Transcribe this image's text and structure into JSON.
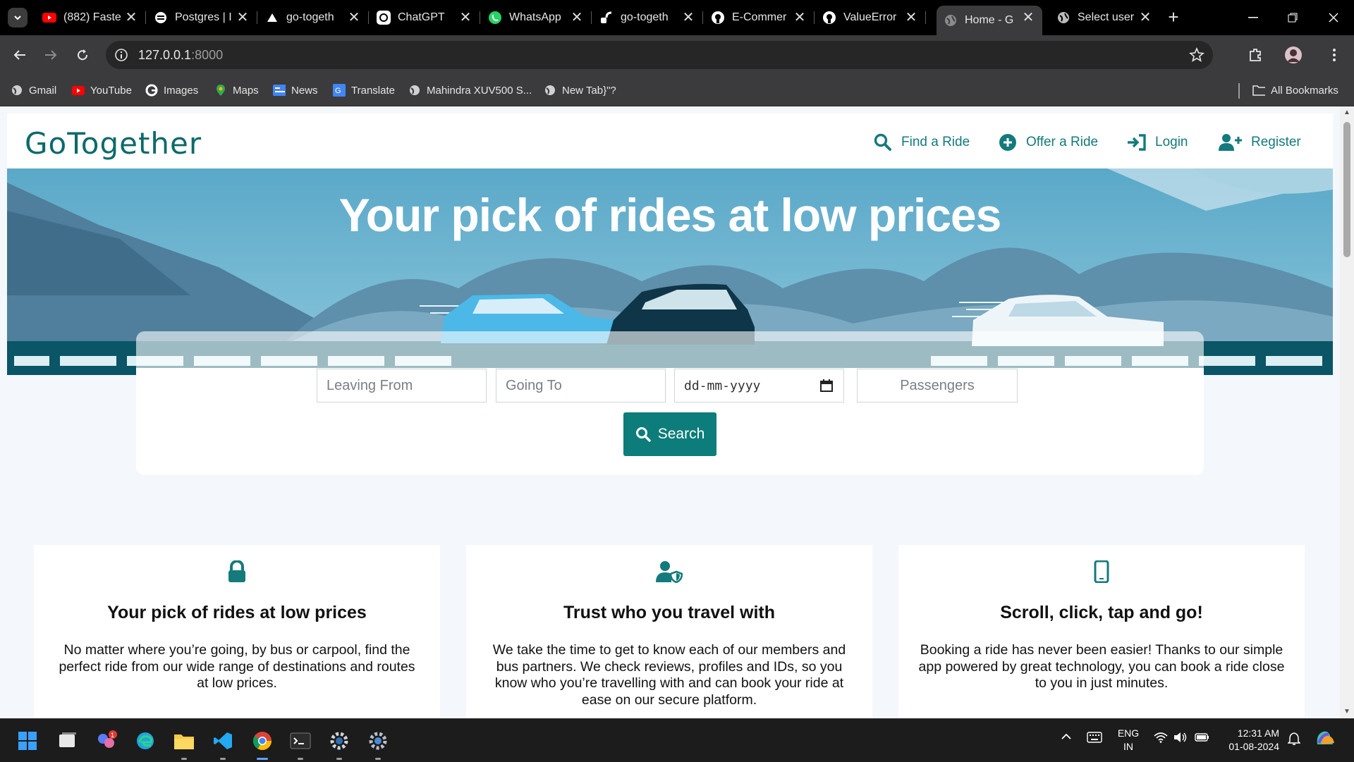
{
  "browser": {
    "tabs": [
      {
        "title": "(882) Faste",
        "icon": "youtube-icon"
      },
      {
        "title": "Postgres | I",
        "icon": "postgres-icon"
      },
      {
        "title": "go-togeth",
        "icon": "drive-icon"
      },
      {
        "title": "ChatGPT",
        "icon": "chatgpt-icon"
      },
      {
        "title": "WhatsApp",
        "icon": "whatsapp-icon"
      },
      {
        "title": "go-togeth",
        "icon": "render-icon"
      },
      {
        "title": "E-Commer",
        "icon": "github-icon"
      },
      {
        "title": "ValueError",
        "icon": "github-icon"
      },
      {
        "title": "Home - Go",
        "icon": "globe-icon",
        "active": true
      },
      {
        "title": "Select user",
        "icon": "globe-icon"
      }
    ],
    "url_host": "127.0.0.1",
    "url_port": ":8000",
    "bookmarks": [
      {
        "label": "Gmail",
        "icon": "globe-icon"
      },
      {
        "label": "YouTube",
        "icon": "youtube-icon"
      },
      {
        "label": "Images",
        "icon": "google-icon"
      },
      {
        "label": "Maps",
        "icon": "maps-icon"
      },
      {
        "label": "News",
        "icon": "news-icon"
      },
      {
        "label": "Translate",
        "icon": "translate-icon"
      },
      {
        "label": "Mahindra XUV500 S...",
        "icon": "globe-icon"
      },
      {
        "label": "New Tab}\"?",
        "icon": "globe-icon"
      }
    ],
    "all_bookmarks": "All Bookmarks"
  },
  "site": {
    "brand": "GoTogether",
    "nav": {
      "find": "Find a Ride",
      "offer": "Offer a Ride",
      "login": "Login",
      "register": "Register"
    },
    "hero_title": "Your pick of rides at low prices",
    "search": {
      "leaving_placeholder": "Leaving From",
      "going_placeholder": "Going To",
      "date_placeholder": "dd-mm-yyyy",
      "passengers_placeholder": "Passengers",
      "button": "Search"
    },
    "features": [
      {
        "icon": "lock-icon",
        "title": "Your pick of rides at low prices",
        "text": "No matter where you’re going, by bus or carpool, find the perfect ride from our wide range of destinations and routes at low prices."
      },
      {
        "icon": "user-shield-icon",
        "title": "Trust who you travel with",
        "text": "We take the time to get to know each of our members and bus partners. We check reviews, profiles and IDs, so you know who you’re travelling with and can book your ride at ease on our secure platform."
      },
      {
        "icon": "mobile-icon",
        "title": "Scroll, click, tap and go!",
        "text": "Booking a ride has never been easier! Thanks to our simple app powered by great technology, you can book a ride close to you in just minutes."
      }
    ],
    "colors": {
      "accent": "#0c7d7a",
      "hero_sky": "#6fb6d0",
      "hero_mountain": "#3f6f8c",
      "road": "#0a5566"
    }
  },
  "taskbar": {
    "notification_badge": "1",
    "lang_line1": "ENG",
    "lang_line2": "IN",
    "time": "12:31 AM",
    "date": "01-08-2024"
  }
}
